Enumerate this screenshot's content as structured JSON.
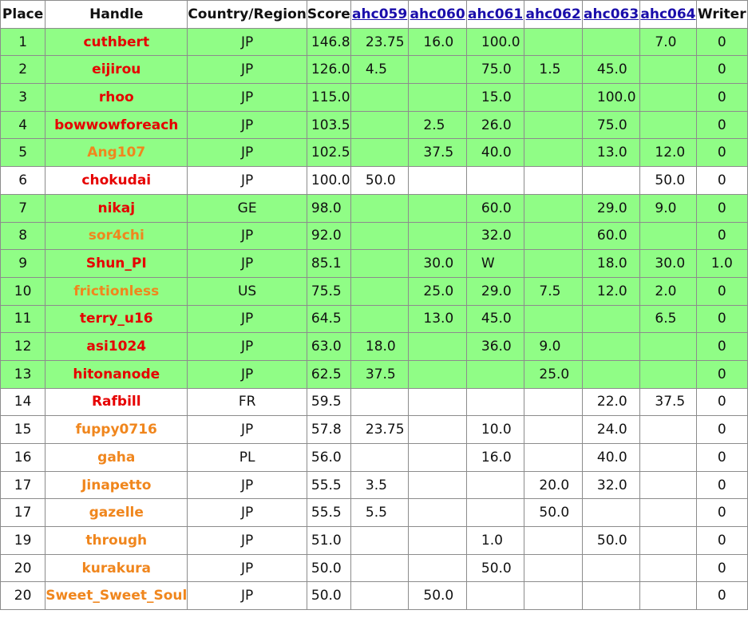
{
  "colors": {
    "highlight_row": "#90fd86",
    "red_handle": "#e60000",
    "orange_handle": "#f0861d",
    "link": "#1a0dab"
  },
  "headers": {
    "place": "Place",
    "handle": "Handle",
    "country": "Country/Region",
    "score": "Score",
    "problems": [
      "ahc059",
      "ahc060",
      "ahc061",
      "ahc062",
      "ahc063",
      "ahc064"
    ],
    "writer": "Writer"
  },
  "rows": [
    {
      "place": "1",
      "handle": "cuthbert",
      "handle_color": "red",
      "highlighted": true,
      "country": "JP",
      "score": "146.8",
      "problems": [
        "23.75",
        "16.0",
        "100.0",
        "",
        "",
        "7.0"
      ],
      "writer": "0"
    },
    {
      "place": "2",
      "handle": "eijirou",
      "handle_color": "red",
      "highlighted": true,
      "country": "JP",
      "score": "126.0",
      "problems": [
        "4.5",
        "",
        "75.0",
        "1.5",
        "45.0",
        ""
      ],
      "writer": "0"
    },
    {
      "place": "3",
      "handle": "rhoo",
      "handle_color": "red",
      "highlighted": true,
      "country": "JP",
      "score": "115.0",
      "problems": [
        "",
        "",
        "15.0",
        "",
        "100.0",
        ""
      ],
      "writer": "0"
    },
    {
      "place": "4",
      "handle": "bowwowforeach",
      "handle_color": "red",
      "highlighted": true,
      "country": "JP",
      "score": "103.5",
      "problems": [
        "",
        "2.5",
        "26.0",
        "",
        "75.0",
        ""
      ],
      "writer": "0"
    },
    {
      "place": "5",
      "handle": "Ang107",
      "handle_color": "orange",
      "highlighted": true,
      "country": "JP",
      "score": "102.5",
      "problems": [
        "",
        "37.5",
        "40.0",
        "",
        "13.0",
        "12.0"
      ],
      "writer": "0"
    },
    {
      "place": "6",
      "handle": "chokudai",
      "handle_color": "red",
      "highlighted": false,
      "country": "JP",
      "score": "100.0",
      "problems": [
        "50.0",
        "",
        "",
        "",
        "",
        "50.0"
      ],
      "writer": "0"
    },
    {
      "place": "7",
      "handle": "nikaj",
      "handle_color": "red",
      "highlighted": true,
      "country": "GE",
      "score": "98.0",
      "problems": [
        "",
        "",
        "60.0",
        "",
        "29.0",
        "9.0"
      ],
      "writer": "0"
    },
    {
      "place": "8",
      "handle": "sor4chi",
      "handle_color": "orange",
      "highlighted": true,
      "country": "JP",
      "score": "92.0",
      "problems": [
        "",
        "",
        "32.0",
        "",
        "60.0",
        ""
      ],
      "writer": "0"
    },
    {
      "place": "9",
      "handle": "Shun_PI",
      "handle_color": "red",
      "highlighted": true,
      "country": "JP",
      "score": "85.1",
      "problems": [
        "",
        "30.0",
        "W",
        "",
        "18.0",
        "30.0"
      ],
      "writer": "1.0"
    },
    {
      "place": "10",
      "handle": "frictionless",
      "handle_color": "orange",
      "highlighted": true,
      "country": "US",
      "score": "75.5",
      "problems": [
        "",
        "25.0",
        "29.0",
        "7.5",
        "12.0",
        "2.0"
      ],
      "writer": "0"
    },
    {
      "place": "11",
      "handle": "terry_u16",
      "handle_color": "red",
      "highlighted": true,
      "country": "JP",
      "score": "64.5",
      "problems": [
        "",
        "13.0",
        "45.0",
        "",
        "",
        "6.5"
      ],
      "writer": "0"
    },
    {
      "place": "12",
      "handle": "asi1024",
      "handle_color": "red",
      "highlighted": true,
      "country": "JP",
      "score": "63.0",
      "problems": [
        "18.0",
        "",
        "36.0",
        "9.0",
        "",
        ""
      ],
      "writer": "0"
    },
    {
      "place": "13",
      "handle": "hitonanode",
      "handle_color": "red",
      "highlighted": true,
      "country": "JP",
      "score": "62.5",
      "problems": [
        "37.5",
        "",
        "",
        "25.0",
        "",
        ""
      ],
      "writer": "0"
    },
    {
      "place": "14",
      "handle": "Rafbill",
      "handle_color": "red",
      "highlighted": false,
      "country": "FR",
      "score": "59.5",
      "problems": [
        "",
        "",
        "",
        "",
        "22.0",
        "37.5"
      ],
      "writer": "0"
    },
    {
      "place": "15",
      "handle": "fuppy0716",
      "handle_color": "orange",
      "highlighted": false,
      "country": "JP",
      "score": "57.8",
      "problems": [
        "23.75",
        "",
        "10.0",
        "",
        "24.0",
        ""
      ],
      "writer": "0"
    },
    {
      "place": "16",
      "handle": "gaha",
      "handle_color": "orange",
      "highlighted": false,
      "country": "PL",
      "score": "56.0",
      "problems": [
        "",
        "",
        "16.0",
        "",
        "40.0",
        ""
      ],
      "writer": "0"
    },
    {
      "place": "17",
      "handle": "Jinapetto",
      "handle_color": "orange",
      "highlighted": false,
      "country": "JP",
      "score": "55.5",
      "problems": [
        "3.5",
        "",
        "",
        "20.0",
        "32.0",
        ""
      ],
      "writer": "0"
    },
    {
      "place": "17",
      "handle": "gazelle",
      "handle_color": "orange",
      "highlighted": false,
      "country": "JP",
      "score": "55.5",
      "problems": [
        "5.5",
        "",
        "",
        "50.0",
        "",
        ""
      ],
      "writer": "0"
    },
    {
      "place": "19",
      "handle": "through",
      "handle_color": "orange",
      "highlighted": false,
      "country": "JP",
      "score": "51.0",
      "problems": [
        "",
        "",
        "1.0",
        "",
        "50.0",
        ""
      ],
      "writer": "0"
    },
    {
      "place": "20",
      "handle": "kurakura",
      "handle_color": "orange",
      "highlighted": false,
      "country": "JP",
      "score": "50.0",
      "problems": [
        "",
        "",
        "50.0",
        "",
        "",
        ""
      ],
      "writer": "0"
    },
    {
      "place": "20",
      "handle": "Sweet_Sweet_Soul",
      "handle_color": "orange",
      "highlighted": false,
      "country": "JP",
      "score": "50.0",
      "problems": [
        "",
        "50.0",
        "",
        "",
        "",
        ""
      ],
      "writer": "0"
    }
  ]
}
